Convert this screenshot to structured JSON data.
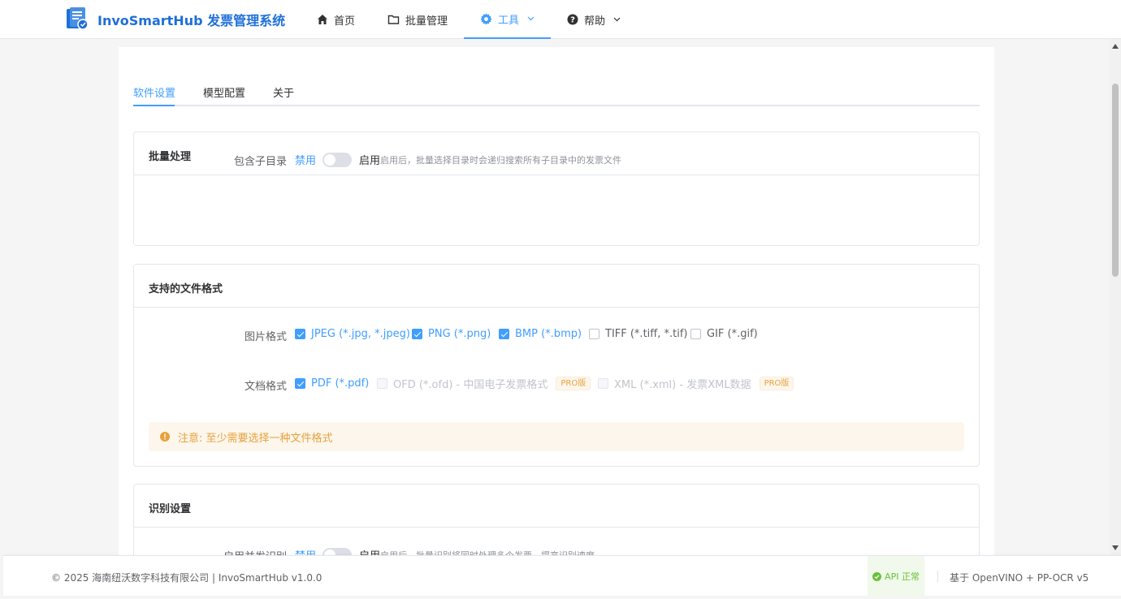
{
  "app": {
    "title": "InvoSmartHub 发票管理系统"
  },
  "nav": [
    {
      "label": "首页",
      "icon": "home-icon"
    },
    {
      "label": "批量管理",
      "icon": "folder-icon"
    },
    {
      "label": "工具",
      "icon": "gear-icon",
      "active": true
    },
    {
      "label": "帮助",
      "icon": "help-icon"
    }
  ],
  "tabs": [
    {
      "label": "软件设置",
      "active": true
    },
    {
      "label": "模型配置"
    },
    {
      "label": "关于"
    }
  ],
  "batch": {
    "title": "批量处理",
    "subdir_label": "包含子目录",
    "off_label": "禁用",
    "on_label": "启用",
    "hint": "启用后，批量选择目录时会递归搜索所有子目录中的发票文件",
    "enabled": false
  },
  "formats": {
    "title": "支持的文件格式",
    "image_label": "图片格式",
    "image_options": [
      {
        "label": "JPEG (*.jpg, *.jpeg)",
        "checked": true
      },
      {
        "label": "PNG (*.png)",
        "checked": true
      },
      {
        "label": "BMP (*.bmp)",
        "checked": true
      },
      {
        "label": "TIFF (*.tiff, *.tif)",
        "checked": false
      },
      {
        "label": "GIF (*.gif)",
        "checked": false
      }
    ],
    "doc_label": "文档格式",
    "doc_options": [
      {
        "label": "PDF (*.pdf)",
        "checked": true
      },
      {
        "label": "OFD (*.ofd) - 中国电子发票格式",
        "checked": false,
        "disabled": true,
        "badge": "PRO版"
      },
      {
        "label": "XML (*.xml) - 发票XML数据",
        "checked": false,
        "disabled": true,
        "badge": "PRO版"
      }
    ],
    "warning": "注意: 至少需要选择一种文件格式"
  },
  "recognition": {
    "title": "识别设置",
    "concurrent_label": "启用并发识别",
    "off_label": "禁用",
    "on_label": "启用",
    "hint": "启用后，批量识别将同时处理多个发票，提高识别速度",
    "enabled": false
  },
  "footer": {
    "copyright": "© 2025 海南纽沃数字科技有限公司 | InvoSmartHub v1.0.0",
    "api_status": "API 正常",
    "engine": "基于 OpenVINO + PP-OCR v5"
  },
  "colors": {
    "primary": "#409eff",
    "brand": "#1e6fd9",
    "warning": "#e6a23c",
    "success": "#67c23a"
  }
}
